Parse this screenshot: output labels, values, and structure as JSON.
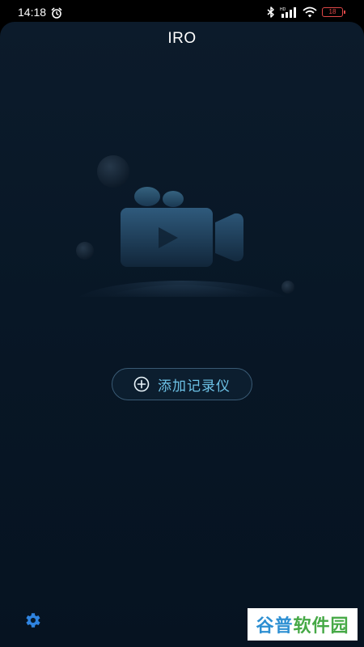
{
  "status_bar": {
    "time": "14:18",
    "battery_level": "18",
    "icons": [
      "alarm-icon",
      "bluetooth-icon",
      "hd-signal-icon",
      "wifi-icon",
      "battery-icon"
    ]
  },
  "header": {
    "title": "IRO"
  },
  "main": {
    "illustration": "video-camera-illustration",
    "add_button_label": "添加记录仪",
    "add_button_icon": "plus-circle-icon"
  },
  "footer": {
    "settings_icon": "settings-gear-icon"
  },
  "watermark": {
    "part1": "谷普",
    "part2": "软件园"
  },
  "colors": {
    "background": "#081726",
    "accent": "#6dc2e6",
    "settings": "#2f84e0",
    "battery_low": "#e04848"
  }
}
